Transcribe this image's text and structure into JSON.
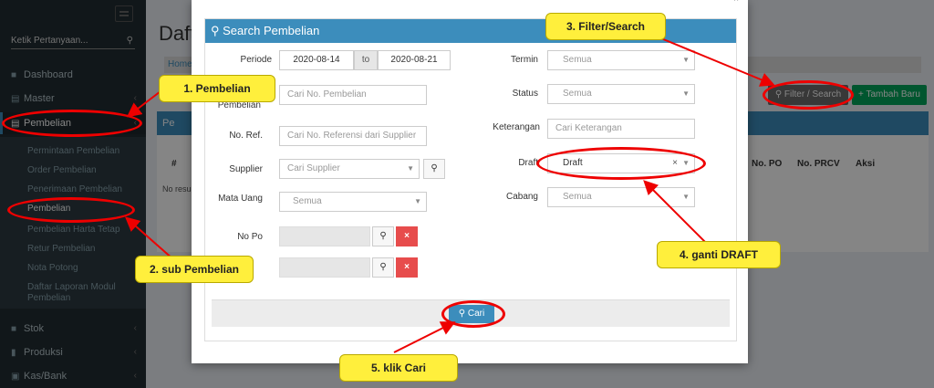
{
  "sidebar": {
    "search_placeholder": "Ketik Pertanyaan...",
    "items": [
      {
        "label": "Dashboard",
        "icon": "dashboard-icon"
      },
      {
        "label": "Master",
        "icon": "database-icon"
      },
      {
        "label": "Pembelian",
        "icon": "cart-icon"
      },
      {
        "label": "Stok",
        "icon": "box-icon"
      },
      {
        "label": "Produksi",
        "icon": "chart-icon"
      },
      {
        "label": "Kas/Bank",
        "icon": "bank-icon"
      }
    ],
    "sub_items": [
      "Permintaan Pembelian",
      "Order Pembelian",
      "Penerimaan Pembelian",
      "Pembelian",
      "Pembelian Harta Tetap",
      "Retur Pembelian",
      "Nota Potong",
      "Daftar Laporan Modul Pembelian"
    ]
  },
  "page": {
    "title": "Daft",
    "breadcrumb": "Home",
    "filter_button": "Filter / Search",
    "add_button": "Tambah Baru",
    "box_title": "Pe",
    "columns": [
      "#",
      "No. PO",
      "No. PRCV",
      "Aksi"
    ],
    "no_results": "No resu"
  },
  "modal": {
    "panel_title": "Search Pembelian",
    "periode_label": "Periode",
    "date_from": "2020-08-14",
    "date_to_label": "to",
    "date_to": "2020-08-21",
    "no_pembelian_label": "Pembelian",
    "no_pembelian_placeholder": "Cari No. Pembelian",
    "no_ref_label": "No. Ref.",
    "no_ref_placeholder": "Cari No. Referensi dari Supplier",
    "supplier_label": "Supplier",
    "supplier_placeholder": "Cari Supplier",
    "mata_uang_label": "Mata Uang",
    "mata_uang_value": "Semua",
    "no_po_label": "No Po",
    "termin_label": "Termin",
    "termin_value": "Semua",
    "status_label": "Status",
    "status_value": "Semua",
    "keterangan_label": "Keterangan",
    "keterangan_placeholder": "Cari Keterangan",
    "draft_label": "Draft",
    "draft_value": "Draft",
    "cabang_label": "Cabang",
    "cabang_value": "Semua",
    "cari_button": "Cari"
  },
  "callouts": {
    "c1": "1. Pembelian",
    "c2": "2. sub Pembelian",
    "c3": "3. Filter/Search",
    "c4": "4. ganti DRAFT",
    "c5": "5. klik Cari"
  },
  "colors": {
    "primary": "#3c8dbc",
    "success": "#00a65a",
    "callout": "#ffef3c",
    "highlight": "#e00000"
  }
}
